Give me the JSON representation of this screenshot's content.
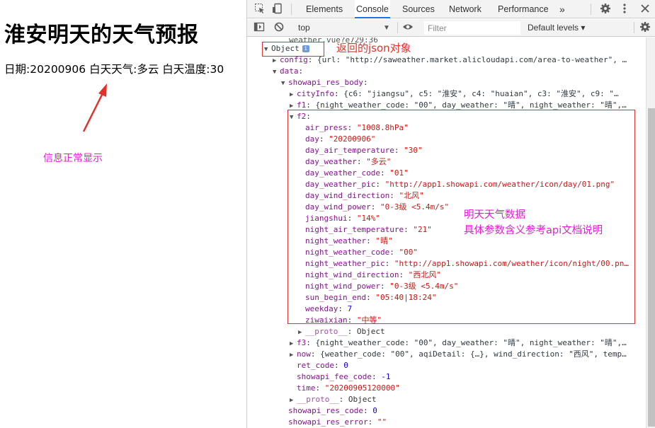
{
  "page": {
    "title": "淮安明天的天气预报",
    "date_label": "日期:",
    "date_value": "20200906",
    "day_weather_label": "白天天气:",
    "day_weather_value": "多云",
    "day_temp_label": "白天温度:",
    "day_temp_value": "30"
  },
  "annotations": {
    "left_note": "信息正常显示",
    "object_note": "返回的json对象",
    "f2_note_line1": "明天天气数据",
    "f2_note_line2": "具体参数含义参考api文档说明",
    "colors": {
      "red": "#e0322a",
      "magenta": "#e020d0"
    }
  },
  "devtools": {
    "tabs": [
      "Elements",
      "Console",
      "Sources",
      "Network",
      "Performance"
    ],
    "active_tab": "Console",
    "more": "»",
    "icons": [
      "inspect-icon",
      "device-toggle-icon",
      "settings-gear-icon",
      "kebab-menu-icon",
      "close-icon"
    ],
    "toolbar": {
      "context": "top",
      "filter_placeholder": "Filter",
      "levels": "Default levels ▾"
    },
    "source_link": "weather.vue?e729:36"
  },
  "console_lines": [
    {
      "indent": 0,
      "tri": "▼",
      "text": "Object"
    },
    {
      "indent": 1,
      "tri": "▶",
      "key": "config",
      "rest": " {url: \"http://saweather.market.alicloudapi.com/area-to-weather\", …"
    },
    {
      "indent": 1,
      "tri": "▼",
      "key": "data",
      "rest": ""
    },
    {
      "indent": 2,
      "tri": "▼",
      "key": "showapi_res_body",
      "rest": ""
    },
    {
      "indent": 3,
      "tri": "▶",
      "key": "cityInfo",
      "rest": " {c6: \"jiangsu\", c5: \"淮安\", c4: \"huaian\", c3: \"淮安\", c9: \"…"
    },
    {
      "indent": 3,
      "tri": "▶",
      "key": "f1",
      "rest": " {night_weather_code: \"00\", day_weather: \"晴\", night_weather: \"晴\",…"
    },
    {
      "indent": 3,
      "tri": "▼",
      "key": "f2",
      "rest": ""
    },
    {
      "indent": 4,
      "tri": "",
      "key": "air_press",
      "val": "\"1008.8hPa\"",
      "t": "s"
    },
    {
      "indent": 4,
      "tri": "",
      "key": "day",
      "val": "\"20200906\"",
      "t": "s"
    },
    {
      "indent": 4,
      "tri": "",
      "key": "day_air_temperature",
      "val": "\"30\"",
      "t": "s"
    },
    {
      "indent": 4,
      "tri": "",
      "key": "day_weather",
      "val": "\"多云\"",
      "t": "s"
    },
    {
      "indent": 4,
      "tri": "",
      "key": "day_weather_code",
      "val": "\"01\"",
      "t": "s"
    },
    {
      "indent": 4,
      "tri": "",
      "key": "day_weather_pic",
      "val": "\"http://app1.showapi.com/weather/icon/day/01.png\"",
      "t": "s"
    },
    {
      "indent": 4,
      "tri": "",
      "key": "day_wind_direction",
      "val": "\"北风\"",
      "t": "s"
    },
    {
      "indent": 4,
      "tri": "",
      "key": "day_wind_power",
      "val": "\"0-3级 <5.4m/s\"",
      "t": "s"
    },
    {
      "indent": 4,
      "tri": "",
      "key": "jiangshui",
      "val": "\"14%\"",
      "t": "s"
    },
    {
      "indent": 4,
      "tri": "",
      "key": "night_air_temperature",
      "val": "\"21\"",
      "t": "s"
    },
    {
      "indent": 4,
      "tri": "",
      "key": "night_weather",
      "val": "\"晴\"",
      "t": "s"
    },
    {
      "indent": 4,
      "tri": "",
      "key": "night_weather_code",
      "val": "\"00\"",
      "t": "s"
    },
    {
      "indent": 4,
      "tri": "",
      "key": "night_weather_pic",
      "val": "\"http://app1.showapi.com/weather/icon/night/00.pn…",
      "t": "s"
    },
    {
      "indent": 4,
      "tri": "",
      "key": "night_wind_direction",
      "val": "\"西北风\"",
      "t": "s"
    },
    {
      "indent": 4,
      "tri": "",
      "key": "night_wind_power",
      "val": "\"0-3级 <5.4m/s\"",
      "t": "s"
    },
    {
      "indent": 4,
      "tri": "",
      "key": "sun_begin_end",
      "val": "\"05:40|18:24\"",
      "t": "s"
    },
    {
      "indent": 4,
      "tri": "",
      "key": "weekday",
      "val": "7",
      "t": "n"
    },
    {
      "indent": 4,
      "tri": "",
      "key": "ziwaixian",
      "val": "\"中等\"",
      "t": "s"
    },
    {
      "indent": 4,
      "tri": "▶",
      "key": "__proto__",
      "val": "Object",
      "t": "g",
      "dim": true
    },
    {
      "indent": 3,
      "tri": "▶",
      "key": "f3",
      "rest": " {night_weather_code: \"00\", day_weather: \"晴\", night_weather: \"晴\",…"
    },
    {
      "indent": 3,
      "tri": "▶",
      "key": "now",
      "rest": " {weather_code: \"00\", aqiDetail: {…}, wind_direction: \"西风\", temp…"
    },
    {
      "indent": 3,
      "tri": "",
      "key": "ret_code",
      "val": "0",
      "t": "n"
    },
    {
      "indent": 3,
      "tri": "",
      "key": "showapi_fee_code",
      "val": "-1",
      "t": "n"
    },
    {
      "indent": 3,
      "tri": "",
      "key": "time",
      "val": "\"20200905120000\"",
      "t": "s"
    },
    {
      "indent": 3,
      "tri": "▶",
      "key": "__proto__",
      "val": "Object",
      "t": "g",
      "dim": true
    },
    {
      "indent": 2,
      "tri": "",
      "key": "showapi_res_code",
      "val": "0",
      "t": "n"
    },
    {
      "indent": 2,
      "tri": "",
      "key": "showapi_res_error",
      "val": "\"\"",
      "t": "s"
    }
  ]
}
